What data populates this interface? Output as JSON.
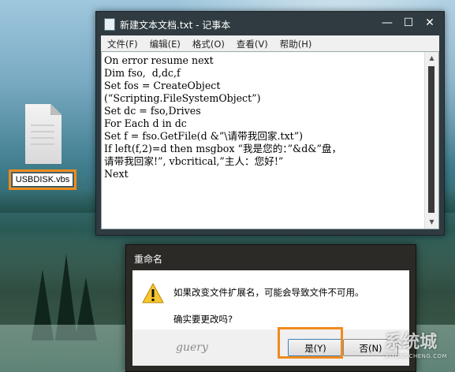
{
  "desktop": {
    "file_label": "USBDISK.vbs"
  },
  "notepad": {
    "title": "新建文本文档.txt - 记事本",
    "controls": {
      "minimize": "—",
      "maximize": "☐",
      "close": "✕"
    },
    "menu": [
      "文件(F)",
      "编辑(E)",
      "格式(O)",
      "查看(V)",
      "帮助(H)"
    ],
    "content": "On error resume next\nDim fso,  d,dc,f\nSet fos = CreateObject\n(“Scripting.FileSystemObject”)\nSet dc = fso,Drives\nFor Each d in dc\nSet f = fso.GetFile(d &”\\请带我回家.txt”)\nIf left(f,2)=d then msgbox “我是您的：”&d&”盘，\n请带我回家!”, vbcritical,”主人：您好!”\nNext"
  },
  "dialog": {
    "title": "重命名",
    "message_1": "如果改变文件扩展名，可能会导致文件不可用。",
    "message_2": "确实要更改吗?",
    "yes_label": "是(Y)",
    "no_label": "否(N)",
    "signature_text": "guery"
  },
  "watermark": {
    "main": "系统城",
    "sub": "XITONGCHENG.COM"
  },
  "colors": {
    "highlight": "#f08a1c",
    "notepad_frame": "#2f3b40",
    "dialog_frame": "#2c2a26"
  }
}
